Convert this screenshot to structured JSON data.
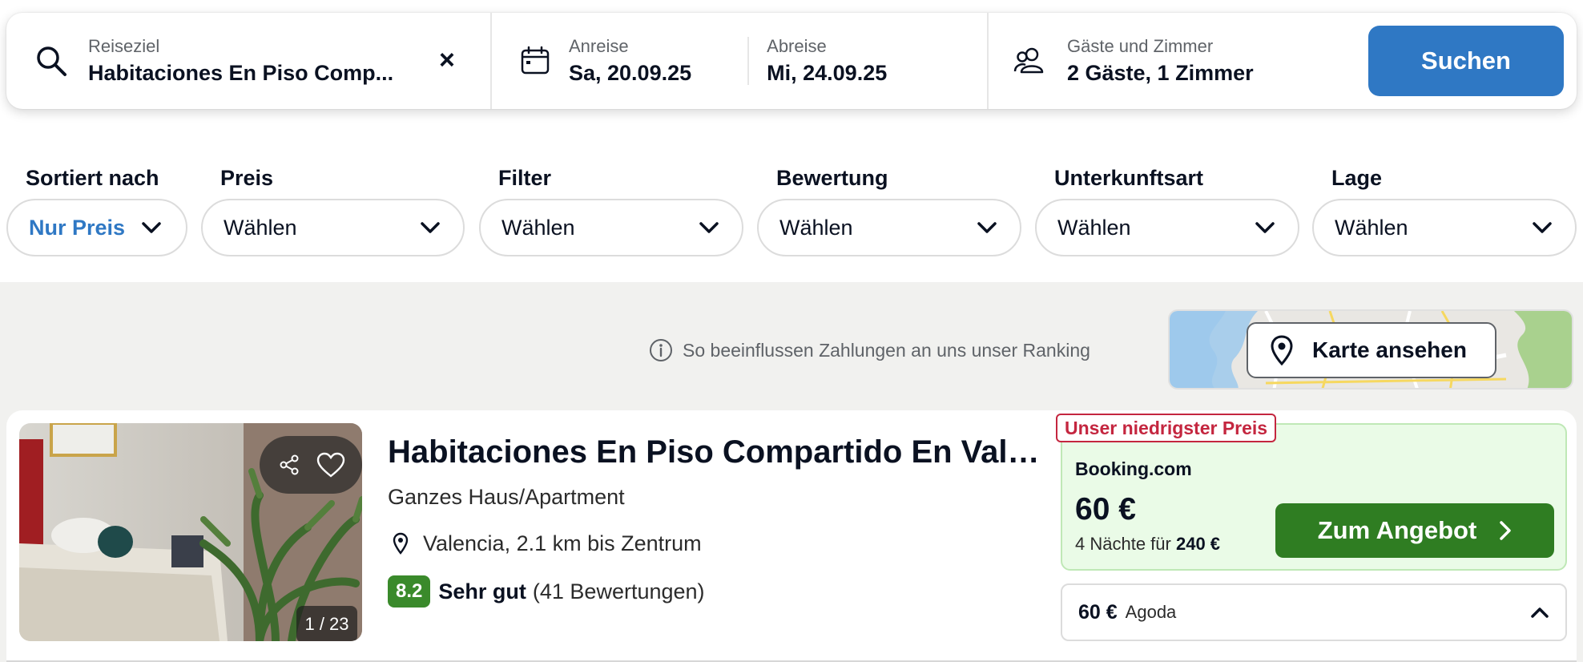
{
  "search": {
    "destination_label": "Reiseziel",
    "destination_value": "Habitaciones En Piso Comp...",
    "clear_symbol": "×",
    "checkin_label": "Anreise",
    "checkin_value": "Sa, 20.09.25",
    "checkout_label": "Abreise",
    "checkout_value": "Mi, 24.09.25",
    "guests_label": "Gäste und Zimmer",
    "guests_value": "2 Gäste, 1 Zimmer",
    "search_button": "Suchen",
    "icons": [
      "search-icon",
      "calendar-icon",
      "guests-icon"
    ]
  },
  "filters": [
    {
      "label": "Sortiert nach",
      "value": "Nur Preis"
    },
    {
      "label": "Preis",
      "value": "Wählen"
    },
    {
      "label": "Filter",
      "value": "Wählen"
    },
    {
      "label": "Bewertung",
      "value": "Wählen"
    },
    {
      "label": "Unterkunftsart",
      "value": "Wählen"
    },
    {
      "label": "Lage",
      "value": "Wählen"
    }
  ],
  "ranking_note": "So beeinflussen Zahlungen an uns unser Ranking",
  "map_button": "Karte ansehen",
  "result": {
    "title": "Habitaciones En Piso Compartido En Vale...",
    "type": "Ganzes Haus/Apartment",
    "location": "Valencia, 2.1 km bis Zentrum",
    "score": "8.2",
    "rating_label": "Sehr gut",
    "reviews": "(41 Bewertungen)",
    "photo_counter": "1 / 23",
    "deal": {
      "badge": "Unser niedrigster Preis",
      "provider": "Booking.com",
      "price": "60 €",
      "nights_text": "4 Nächte für",
      "total": "240 €",
      "button": "Zum Angebot"
    },
    "alt_deal": {
      "price": "60 €",
      "provider": "Agoda"
    }
  },
  "colors": {
    "accent_blue": "#2f78c4",
    "deal_green": "#2f7d22",
    "score_green": "#3a8a2b",
    "badge_red": "#c4263f",
    "gray_bg": "#f1f1ef"
  }
}
